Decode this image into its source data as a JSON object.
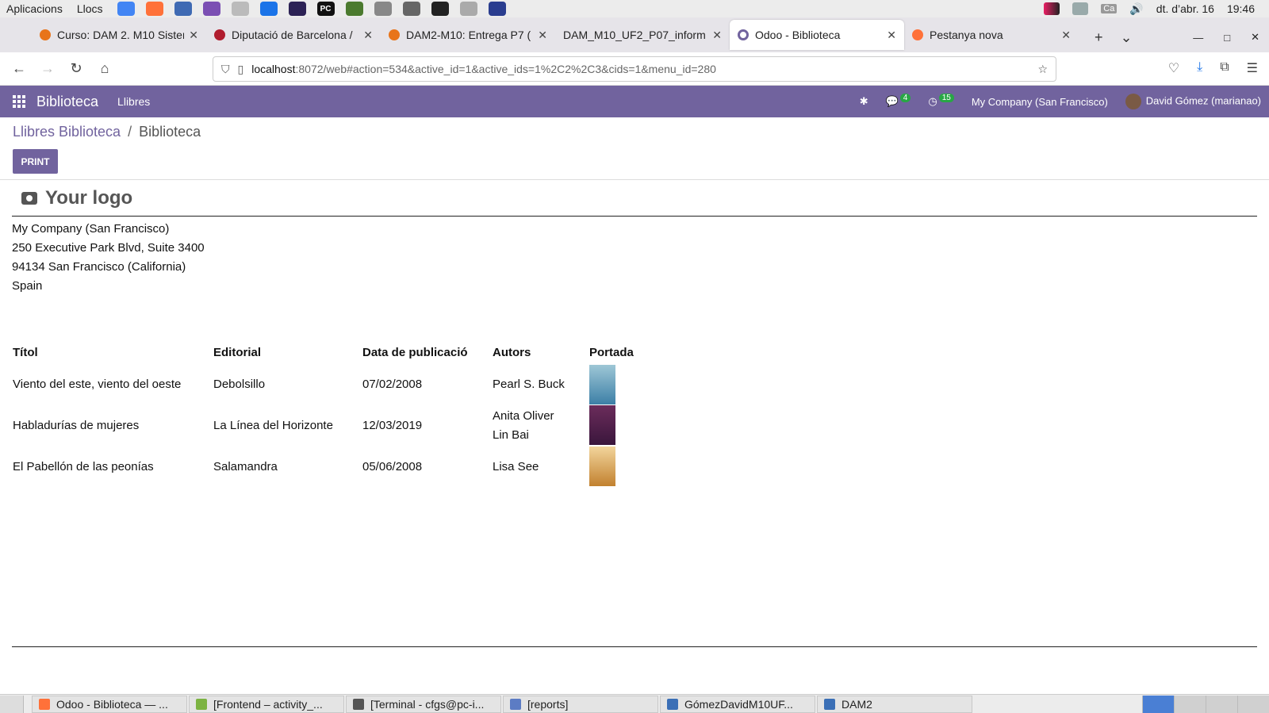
{
  "system_bar": {
    "apps_menu": "Aplicacions",
    "places_menu": "Llocs",
    "lang": "Ca",
    "date": "dt. d’abr. 16",
    "time": "19:46"
  },
  "tabs": [
    {
      "title": "Curso: DAM 2. M10 Sistem",
      "color": "#e8741a"
    },
    {
      "title": "Diputació de Barcelona /",
      "color": "#b01c2e"
    },
    {
      "title": "DAM2-M10: Entrega P7 (",
      "color": "#e8741a"
    },
    {
      "title": "DAM_M10_UF2_P07_inform",
      "color": "#cccccc"
    },
    {
      "title": "Odoo - Biblioteca",
      "color": "#71639e"
    },
    {
      "title": "Pestanya nova",
      "color": "#ff7139"
    }
  ],
  "address_bar": {
    "host": "localhost",
    "rest": ":8072/web#action=534&active_id=1&active_ids=1%2C2%2C3&cids=1&menu_id=280"
  },
  "odoo_nav": {
    "brand": "Biblioteca",
    "menu": "Llibres",
    "messages_count": "4",
    "activities_count": "15",
    "company": "My Company (San Francisco)",
    "user": "David Gómez (marianao)"
  },
  "breadcrumb": {
    "parent": "Llibres Biblioteca",
    "separator": "/",
    "current": "Biblioteca"
  },
  "print_label": "PRINT",
  "report": {
    "logo_text": "Your logo",
    "address_lines": [
      "My Company (San Francisco)",
      "250 Executive Park Blvd, Suite 3400",
      "94134 San Francisco (California)",
      "Spain"
    ],
    "headers": [
      "Títol",
      "Editorial",
      "Data de publicació",
      "Autors",
      "Portada"
    ],
    "rows": [
      {
        "title": "Viento del este, viento del oeste",
        "publisher": "Debolsillo",
        "date": "07/02/2008",
        "authors": [
          "Pearl S. Buck"
        ]
      },
      {
        "title": "Habladurías de mujeres",
        "publisher": "La Línea del Horizonte",
        "date": "12/03/2019",
        "authors": [
          "Anita Oliver",
          "Lin Bai"
        ]
      },
      {
        "title": "El Pabellón de las peonías",
        "publisher": "Salamandra",
        "date": "05/06/2008",
        "authors": [
          "Lisa See"
        ]
      }
    ]
  },
  "taskbar": [
    {
      "label": "Odoo - Biblioteca — ...",
      "color": "#ff7139"
    },
    {
      "label": "[Frontend – activity_...",
      "color": "#7cb342"
    },
    {
      "label": "[Terminal - cfgs@pc-i...",
      "color": "#555555"
    },
    {
      "label": "[reports]",
      "color": "#5c7cc4"
    },
    {
      "label": "GómezDavidM10UF...",
      "color": "#3b6fb6"
    },
    {
      "label": "DAM2",
      "color": "#3b6fb6"
    }
  ]
}
